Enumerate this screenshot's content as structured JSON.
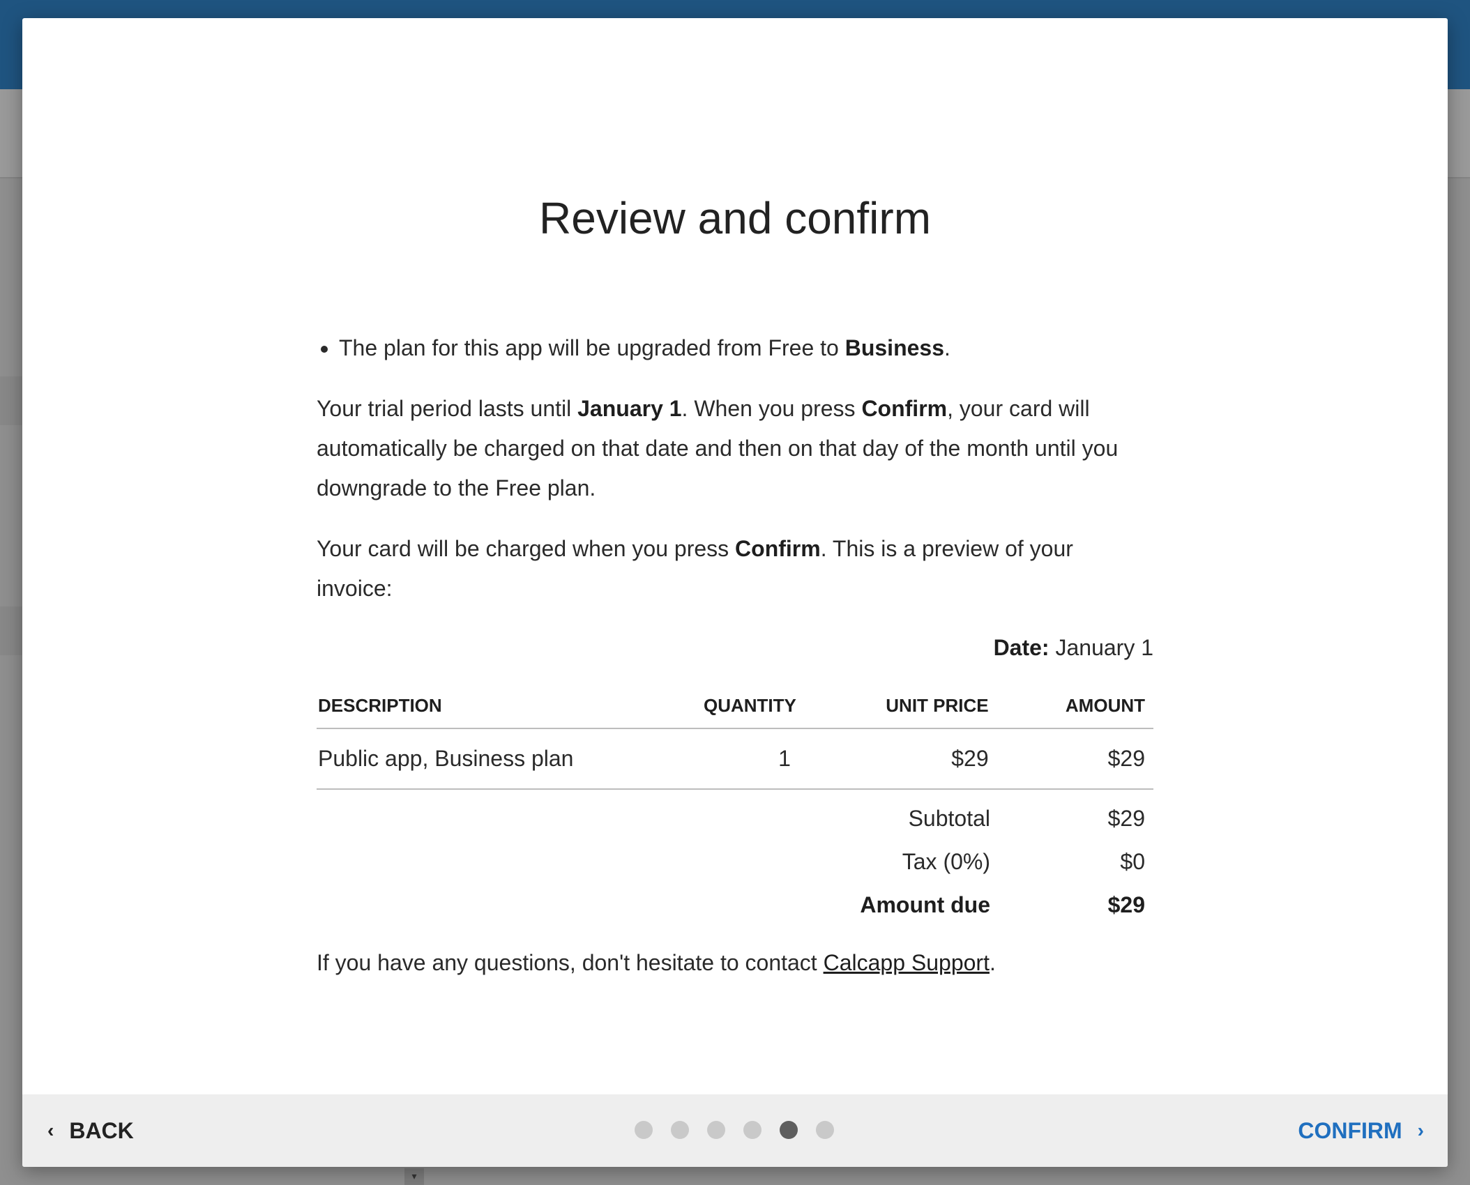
{
  "dialog": {
    "title": "Review and confirm",
    "bullet": {
      "prefix": "The plan for this app will be upgraded from Free to ",
      "plan": "Business",
      "suffix": "."
    },
    "trial": {
      "t1": "Your trial period lasts until ",
      "date": "January 1",
      "t2": ". When you press ",
      "confirm": "Confirm",
      "t3": ", your card will automatically be charged on that date and then on that day of the month until you downgrade to the Free plan."
    },
    "charge": {
      "t1": "Your card will be charged when you press ",
      "confirm": "Confirm",
      "t2": ". This is a preview of your invoice:"
    },
    "invoice": {
      "date_label": "Date:",
      "date_value": "January 1",
      "headers": {
        "description": "DESCRIPTION",
        "quantity": "QUANTITY",
        "unit_price": "UNIT PRICE",
        "amount": "AMOUNT"
      },
      "rows": [
        {
          "description": "Public app, Business plan",
          "quantity": "1",
          "unit_price": "$29",
          "amount": "$29"
        }
      ],
      "subtotal_label": "Subtotal",
      "subtotal_value": "$29",
      "tax_label": "Tax (0%)",
      "tax_value": "$0",
      "due_label": "Amount due",
      "due_value": "$29"
    },
    "help": {
      "t1": "If you have any questions, don't hesitate to contact ",
      "link": "Calcapp Support",
      "t2": "."
    }
  },
  "footer": {
    "back_label": "BACK",
    "confirm_label": "CONFIRM",
    "steps_total": 6,
    "active_step": 5
  },
  "colors": {
    "accent": "#1f6fbf",
    "topbar": "#1f5480",
    "active_dot": "#5e5e5e",
    "inactive_dot": "#c9c9c9"
  },
  "icons": {
    "back": "chevron-left-icon",
    "confirm": "chevron-right-icon"
  }
}
